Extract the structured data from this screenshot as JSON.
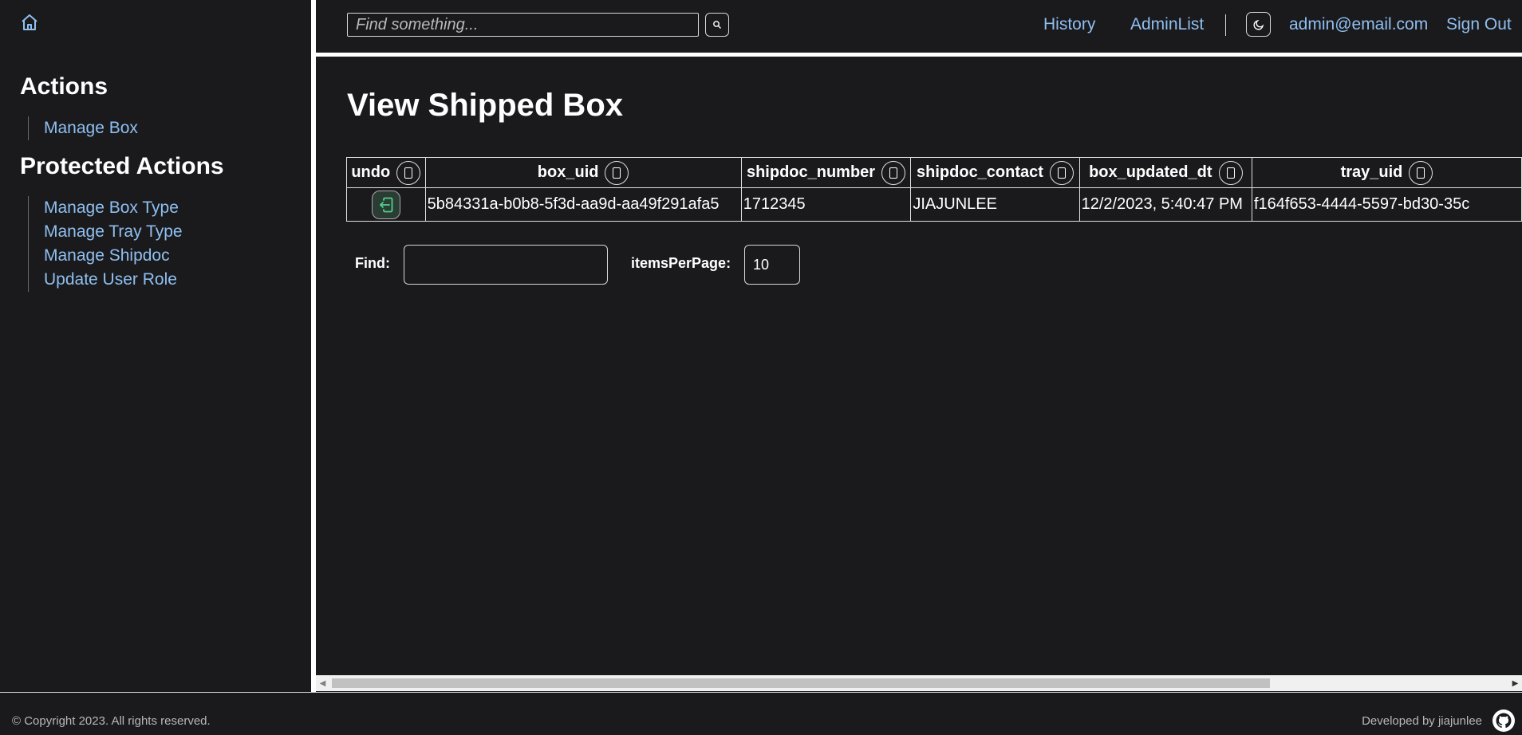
{
  "sidebar": {
    "actions_heading": "Actions",
    "actions": [
      {
        "label": "Manage Box"
      }
    ],
    "protected_heading": "Protected Actions",
    "protected": [
      {
        "label": "Manage Box Type"
      },
      {
        "label": "Manage Tray Type"
      },
      {
        "label": "Manage Shipdoc"
      },
      {
        "label": "Update User Role"
      }
    ]
  },
  "header": {
    "search_placeholder": "Find something...",
    "history_label": "History",
    "adminlist_label": "AdminList",
    "user_email": "admin@email.com",
    "signout_label": "Sign Out"
  },
  "main": {
    "title": "View Shipped Box",
    "columns": [
      "undo",
      "box_uid",
      "shipdoc_number",
      "shipdoc_contact",
      "box_updated_dt",
      "tray_uid"
    ],
    "rows": [
      {
        "box_uid": "5b84331a-b0b8-5f3d-aa9d-aa49f291afa5",
        "shipdoc_number": "1712345",
        "shipdoc_contact": "JIAJUNLEE",
        "box_updated_dt": "12/2/2023, 5:40:47 PM",
        "tray_uid": "f164f653-4444-5597-bd30-35c"
      }
    ],
    "find_label": "Find:",
    "find_value": "",
    "items_per_page_label": "itemsPerPage:",
    "items_per_page_value": "10"
  },
  "footer": {
    "copyright": "© Copyright 2023. All rights reserved.",
    "developed_by": "Developed by jiajunlee"
  },
  "colors": {
    "background": "#1a1a1d",
    "link": "#8fbff0",
    "undo_icon": "#4fd08a"
  }
}
